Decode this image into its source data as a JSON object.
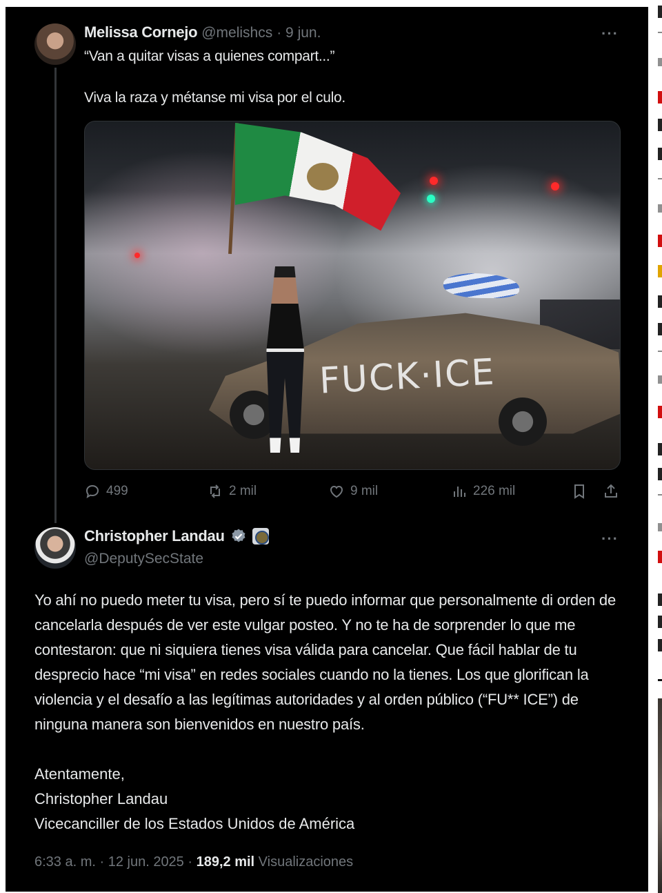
{
  "quoted_tweet": {
    "author_name": "Melissa Cornejo",
    "author_handle": "@melishcs",
    "date": "· 9 jun.",
    "more_label": "···",
    "line1": "“Van a quitar visas a quienes compart...”",
    "line2": "Viva la raza y métanse mi visa por el culo.",
    "image_graffiti": "FUCK·ICE",
    "stats": {
      "replies": "499",
      "reposts": "2 mil",
      "likes": "9 mil",
      "views": "226 mil"
    },
    "icons": [
      "reply-icon",
      "repost-icon",
      "like-icon",
      "views-icon",
      "bookmark-icon",
      "share-icon"
    ]
  },
  "main_tweet": {
    "author_name": "Christopher Landau",
    "author_handle": "@DeputySecState",
    "more_label": "···",
    "body": "Yo ahí no puedo meter tu visa, pero sí te puedo informar que personalmente di orden de cancelarla después de ver este vulgar posteo. Y no te ha de sorprender lo que me contestaron: que ni siquiera tienes visa válida para cancelar. Que fácil hablar de tu desprecio hace “mi visa” en redes sociales cuando no la tienes. Los que glorifican la violencia y el desafío a las legítimas autoridades y al orden público (“FU** ICE”) de ninguna manera son bienvenidos en nuestro país.",
    "sign_1": "Atentamente,",
    "sign_2": "Christopher Landau",
    "sign_3": "Vicecanciller de los Estados Unidos de América",
    "meta_time": "6:33 a. m. · 12 jun. 2025 · ",
    "meta_views": "189,2 mil",
    "meta_views_label": " Visualizaciones"
  },
  "colors": {
    "background": "#000000",
    "text": "#e7e9ea",
    "muted": "#71767b",
    "verified": "#1d9bf0"
  }
}
